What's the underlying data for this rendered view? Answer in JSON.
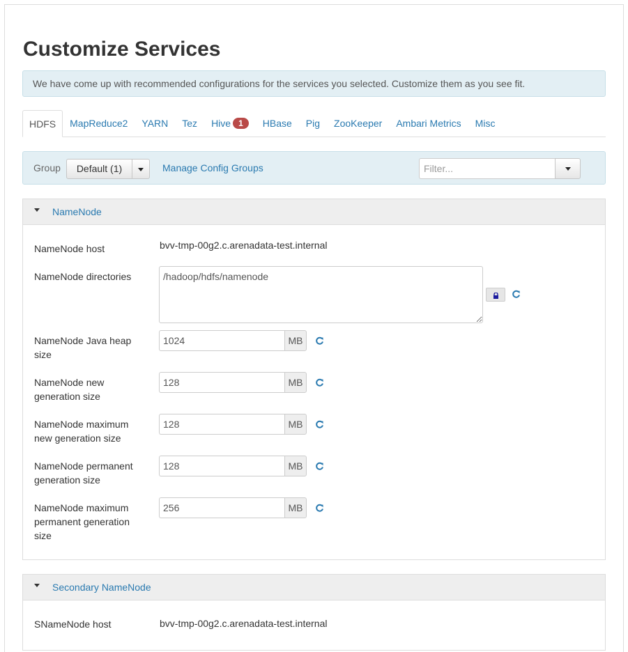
{
  "page": {
    "title": "Customize Services",
    "alert": "We have come up with recommended configurations for the services you selected. Customize them as you see fit."
  },
  "tabs": [
    {
      "label": "HDFS",
      "active": true
    },
    {
      "label": "MapReduce2"
    },
    {
      "label": "YARN"
    },
    {
      "label": "Tez"
    },
    {
      "label": "Hive",
      "badge": "1"
    },
    {
      "label": "HBase"
    },
    {
      "label": "Pig"
    },
    {
      "label": "ZooKeeper"
    },
    {
      "label": "Ambari Metrics"
    },
    {
      "label": "Misc"
    }
  ],
  "toolbar": {
    "group_label": "Group",
    "group_value": "Default (1)",
    "manage_link": "Manage Config Groups",
    "filter_placeholder": "Filter..."
  },
  "namenode": {
    "title": "NameNode",
    "host_label": "NameNode host",
    "host_value": "bvv-tmp-00g2.c.arenadata-test.internal",
    "dirs_label": "NameNode directories",
    "dirs_value": "/hadoop/hdfs/namenode",
    "fields": [
      {
        "label": "NameNode Java heap size",
        "value": "1024",
        "unit": "MB"
      },
      {
        "label": "NameNode new generation size",
        "value": "128",
        "unit": "MB"
      },
      {
        "label": "NameNode maximum new generation size",
        "value": "128",
        "unit": "MB"
      },
      {
        "label": "NameNode permanent generation size",
        "value": "128",
        "unit": "MB"
      },
      {
        "label": "NameNode maximum permanent generation size",
        "value": "256",
        "unit": "MB"
      }
    ]
  },
  "secondary": {
    "title": "Secondary NameNode",
    "host_label": "SNameNode host",
    "host_value": "bvv-tmp-00g2.c.arenadata-test.internal"
  },
  "colors": {
    "link": "#2a7ab0",
    "alert_bg": "#e3eff4",
    "badge": "#b94a48"
  }
}
